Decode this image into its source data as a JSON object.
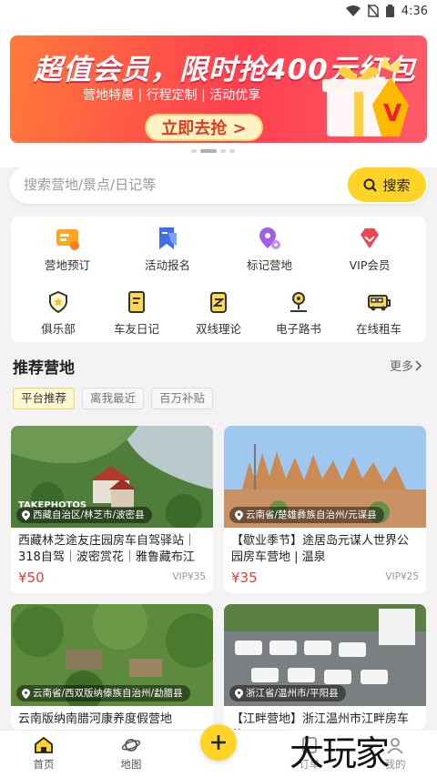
{
  "status_bar": {
    "time": "4:36"
  },
  "banner": {
    "title": "超值会员，限时抢400元红包",
    "subtitle": "营地特惠 | 行程定制 | 活动优享",
    "cta": "立即去抢 >"
  },
  "search": {
    "placeholder": "搜索营地/景点/日记等",
    "button": "搜索"
  },
  "grid": {
    "items": [
      {
        "label": "营地预订",
        "icon": "camp-booking-icon",
        "color": "#ff9d1f"
      },
      {
        "label": "活动报名",
        "icon": "event-signup-icon",
        "color": "#4a7bf0"
      },
      {
        "label": "标记营地",
        "icon": "mark-camp-icon",
        "color": "#a25ee8"
      },
      {
        "label": "VIP会员",
        "icon": "vip-diamond-icon",
        "color": "#f0454f"
      },
      {
        "label": "俱乐部",
        "icon": "club-shield-icon",
        "color": "#f3c31b"
      },
      {
        "label": "车友日记",
        "icon": "diary-icon",
        "color": "#f3c31b"
      },
      {
        "label": "双线理论",
        "icon": "theory-book-icon",
        "color": "#f3c31b"
      },
      {
        "label": "电子路书",
        "icon": "route-book-icon",
        "color": "#f3c31b"
      },
      {
        "label": "在线租车",
        "icon": "rv-rental-icon",
        "color": "#f3c31b"
      }
    ]
  },
  "recommend": {
    "title": "推荐营地",
    "more": "更多",
    "filters": [
      "平台推荐",
      "离我最近",
      "百万补贴"
    ],
    "cards": [
      {
        "location": "西藏自治区/林芝市/波密县",
        "name": "西藏林芝途友庄园房车自驾驿站｜318自驾｜波密赏花｜雅鲁藏布江",
        "price": "¥50",
        "vip": "VIP¥35",
        "photo_text": "TAKEPHOTOS"
      },
      {
        "location": "云南省/楚雄彝族自治州/元谋县",
        "name": "【歇业季节】途居岛元谋人世界公园房车营地 | 温泉",
        "price": "¥35",
        "vip": "VIP¥25"
      },
      {
        "location": "云南省/西双版纳傣族自治州/勐腊县",
        "name": "云南版纳南腊河康养度假营地"
      },
      {
        "location": "浙江省/温州市/平阳县",
        "name": "【江畔营地】浙江温州市江畔房车营"
      }
    ]
  },
  "tabbar": {
    "items": [
      "首页",
      "地图",
      "订单",
      "我的"
    ]
  },
  "watermark": "大玩家",
  "colors": {
    "accent": "#ffd426",
    "price": "#f23b2c"
  }
}
